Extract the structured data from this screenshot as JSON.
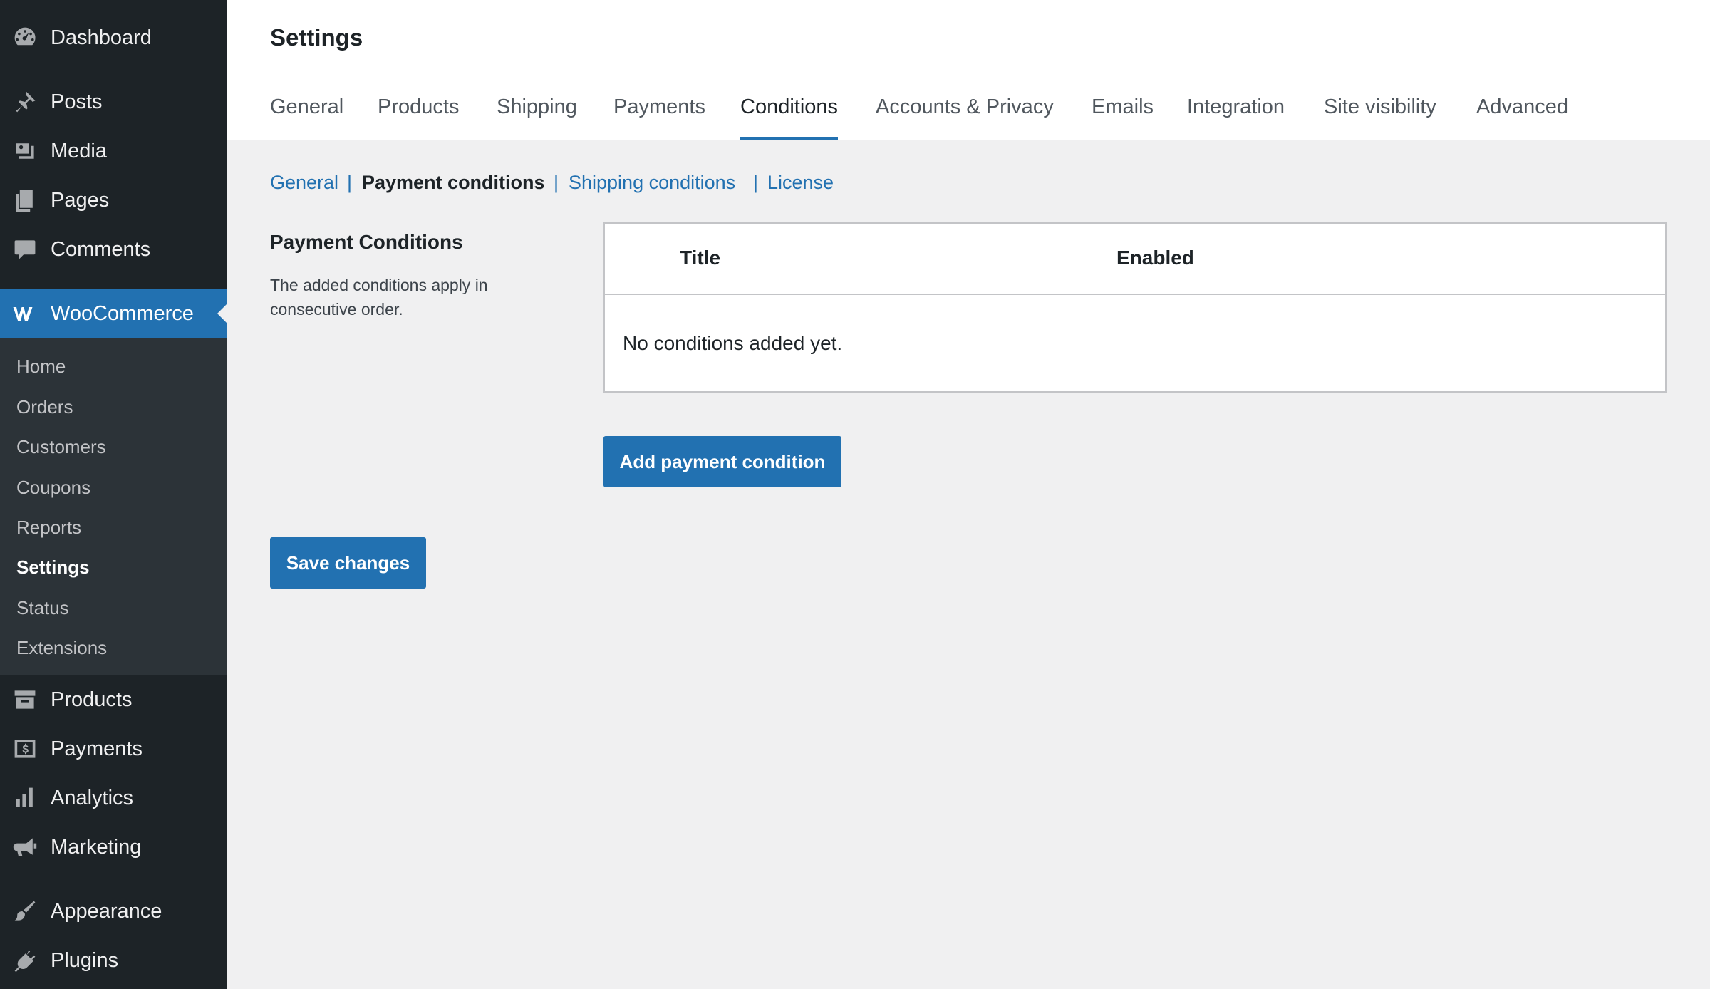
{
  "sidebar": {
    "top_items": [
      {
        "label": "Dashboard",
        "icon": "dashboard-icon"
      },
      {
        "label": "Posts",
        "icon": "pin-icon"
      },
      {
        "label": "Media",
        "icon": "media-icon"
      },
      {
        "label": "Pages",
        "icon": "pages-icon"
      },
      {
        "label": "Comments",
        "icon": "comment-icon"
      }
    ],
    "woocommerce": {
      "label": "WooCommerce",
      "icon": "woocommerce-icon"
    },
    "submenu": [
      "Home",
      "Orders",
      "Customers",
      "Coupons",
      "Reports",
      "Settings",
      "Status",
      "Extensions"
    ],
    "current_submenu": "Settings",
    "bottom_items": [
      {
        "label": "Products",
        "icon": "archive-icon"
      },
      {
        "label": "Payments",
        "icon": "dollar-icon"
      },
      {
        "label": "Analytics",
        "icon": "bar-chart-icon"
      },
      {
        "label": "Marketing",
        "icon": "megaphone-icon"
      },
      {
        "label": "Appearance",
        "icon": "paintbrush-icon"
      },
      {
        "label": "Plugins",
        "icon": "plugin-icon"
      }
    ]
  },
  "header": {
    "title": "Settings",
    "tabs": [
      "General",
      "Products",
      "Shipping",
      "Payments",
      "Conditions",
      "Accounts & Privacy",
      "Emails",
      "Integration",
      "Site visibility",
      "Advanced"
    ],
    "active_tab": "Conditions"
  },
  "subnav": {
    "items": [
      "General",
      "Payment conditions",
      "Shipping conditions",
      "License"
    ],
    "current": "Payment conditions",
    "separator": "|"
  },
  "section": {
    "title": "Payment Conditions",
    "description": "The added conditions apply in consecutive order."
  },
  "table": {
    "columns": [
      "Title",
      "Enabled"
    ],
    "empty_message": "No conditions added yet."
  },
  "buttons": {
    "add_condition": "Add payment condition",
    "save": "Save changes"
  },
  "colors": {
    "sidebar_bg": "#1d2327",
    "submenu_bg": "#2c3338",
    "accent": "#2271b1",
    "page_bg": "#f0f0f1"
  }
}
